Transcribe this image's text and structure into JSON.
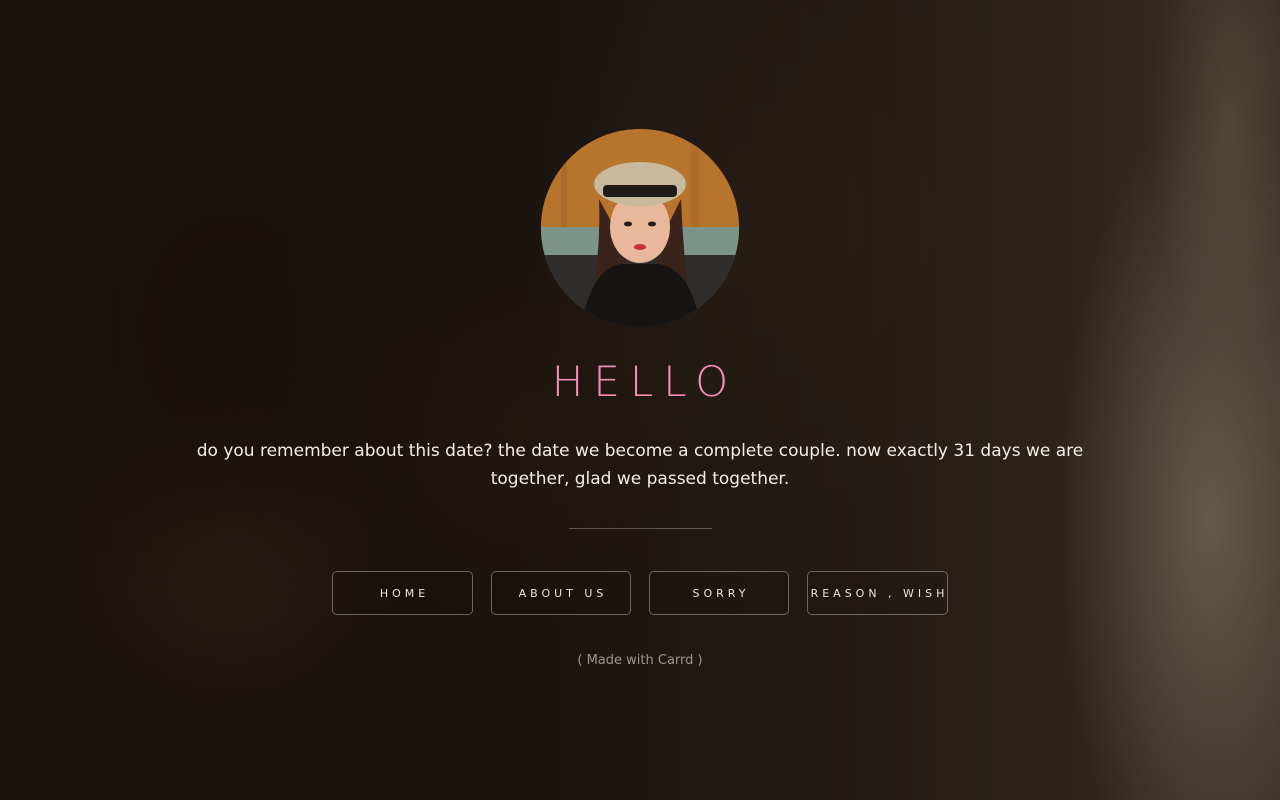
{
  "profile": {
    "avatar_alt": "profile photo"
  },
  "heading": "HELLO",
  "message": "do you remember about this date? the date we become a complete couple. now exactly 31 days we are together, glad we passed together.",
  "nav": {
    "items": [
      {
        "label": "HOME"
      },
      {
        "label": "ABOUT US"
      },
      {
        "label": "SORRY"
      },
      {
        "label": "REASON , WISH"
      }
    ]
  },
  "footer": {
    "credit": "( Made with Carrd )"
  },
  "colors": {
    "heading": "#f28bb5",
    "text": "#f3ede8",
    "button_border": "rgba(255,255,255,0.35)"
  }
}
